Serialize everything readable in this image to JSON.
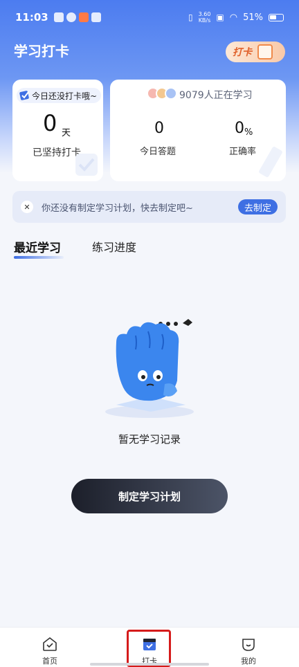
{
  "status_bar": {
    "time": "11:03",
    "net_speed_value": "3.60",
    "net_speed_unit": "KB/s",
    "battery": "51%"
  },
  "header": {
    "title": "学习打卡",
    "badge_label": "打卡"
  },
  "streak_card": {
    "tag": "今日还没打卡哦~",
    "days": "0",
    "unit": "天",
    "label": "已坚持打卡"
  },
  "stats_card": {
    "learning_count": "9079人正在学习",
    "today_answers": "0",
    "today_answers_label": "今日答题",
    "accuracy": "0",
    "accuracy_unit": "%",
    "accuracy_label": "正确率"
  },
  "notice": {
    "text": "你还没有制定学习计划，快去制定吧~",
    "action": "去制定"
  },
  "tabs": [
    {
      "label": "最近学习",
      "active": true
    },
    {
      "label": "练习进度",
      "active": false
    }
  ],
  "empty_state": {
    "text": "暂无学习记录",
    "button": "制定学习计划"
  },
  "bottom_nav": [
    {
      "label": "首页",
      "icon": "home-icon"
    },
    {
      "label": "打卡",
      "icon": "calendar-check-icon",
      "active": true
    },
    {
      "label": "我的",
      "icon": "profile-icon"
    }
  ],
  "colors": {
    "accent": "#3e6fe3",
    "header_gradient_top": "#4c7cf0",
    "highlight": "#d51b1b"
  }
}
